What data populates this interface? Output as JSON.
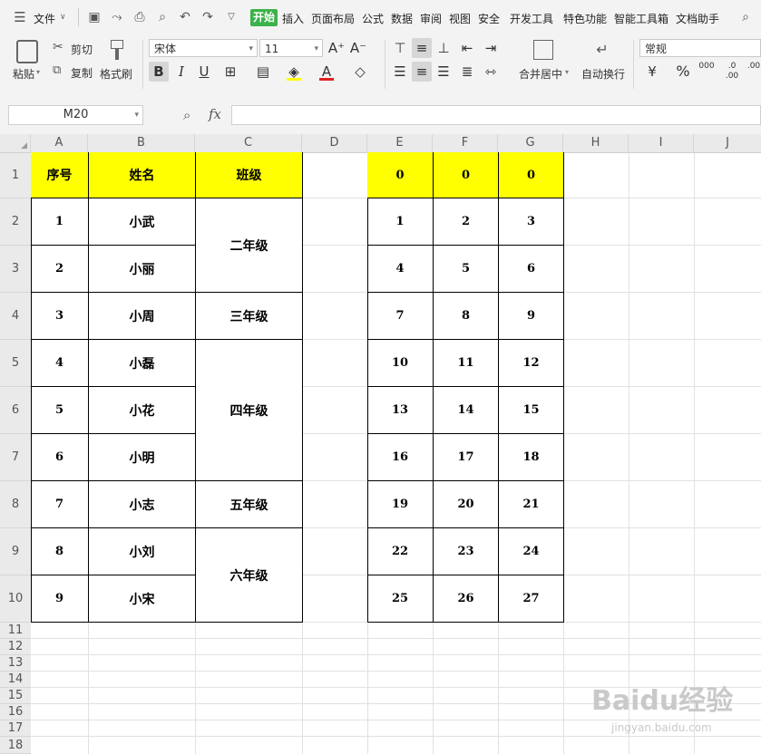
{
  "menu": {
    "file_label": "文件",
    "tabs": [
      "开始",
      "插入",
      "页面布局",
      "公式",
      "数据",
      "审阅",
      "视图",
      "安全",
      "开发工具",
      "特色功能",
      "智能工具箱",
      "文档助手"
    ],
    "active_tab": "开始"
  },
  "ribbon": {
    "paste": "粘贴",
    "cut": "剪切",
    "copy": "复制",
    "format_painter": "格式刷",
    "font_name": "宋体",
    "font_size": "11",
    "merge_center": "合并居中",
    "wrap_text": "自动换行",
    "number_format": "常规",
    "percent": "%",
    "increase_font": "A⁺",
    "decrease_font": "A⁻",
    "bold": "B",
    "italic": "I",
    "underline": "U",
    "currency": "¥"
  },
  "formula_bar": {
    "name_box": "M20",
    "fx": "fx",
    "value": ""
  },
  "columns": [
    "A",
    "B",
    "C",
    "D",
    "E",
    "F",
    "G",
    "H",
    "I",
    "J"
  ],
  "rows": [
    "1",
    "2",
    "3",
    "4",
    "5",
    "6",
    "7",
    "8",
    "9",
    "10",
    "11",
    "12",
    "13",
    "14",
    "15",
    "16",
    "17",
    "18"
  ],
  "table1": {
    "headers": {
      "seq": "序号",
      "name": "姓名",
      "grade": "班级"
    },
    "seq": [
      "1",
      "2",
      "3",
      "4",
      "5",
      "6",
      "7",
      "8",
      "9"
    ],
    "names": [
      "小武",
      "小丽",
      "小周",
      "小磊",
      "小花",
      "小明",
      "小志",
      "小刘",
      "小宋"
    ],
    "grades": [
      "二年级",
      "三年级",
      "四年级",
      "五年级",
      "六年级"
    ]
  },
  "table2": {
    "header": [
      "0",
      "0",
      "0"
    ],
    "rows": [
      [
        "1",
        "2",
        "3"
      ],
      [
        "4",
        "5",
        "6"
      ],
      [
        "7",
        "8",
        "9"
      ],
      [
        "10",
        "11",
        "12"
      ],
      [
        "13",
        "14",
        "15"
      ],
      [
        "16",
        "17",
        "18"
      ],
      [
        "19",
        "20",
        "21"
      ],
      [
        "22",
        "23",
        "24"
      ],
      [
        "25",
        "26",
        "27"
      ]
    ]
  },
  "watermark": {
    "brand": "Baidu经验",
    "url": "jingyan.baidu.com"
  },
  "colors": {
    "header_fill": "#ffff00",
    "accent": "#3bb24a"
  }
}
